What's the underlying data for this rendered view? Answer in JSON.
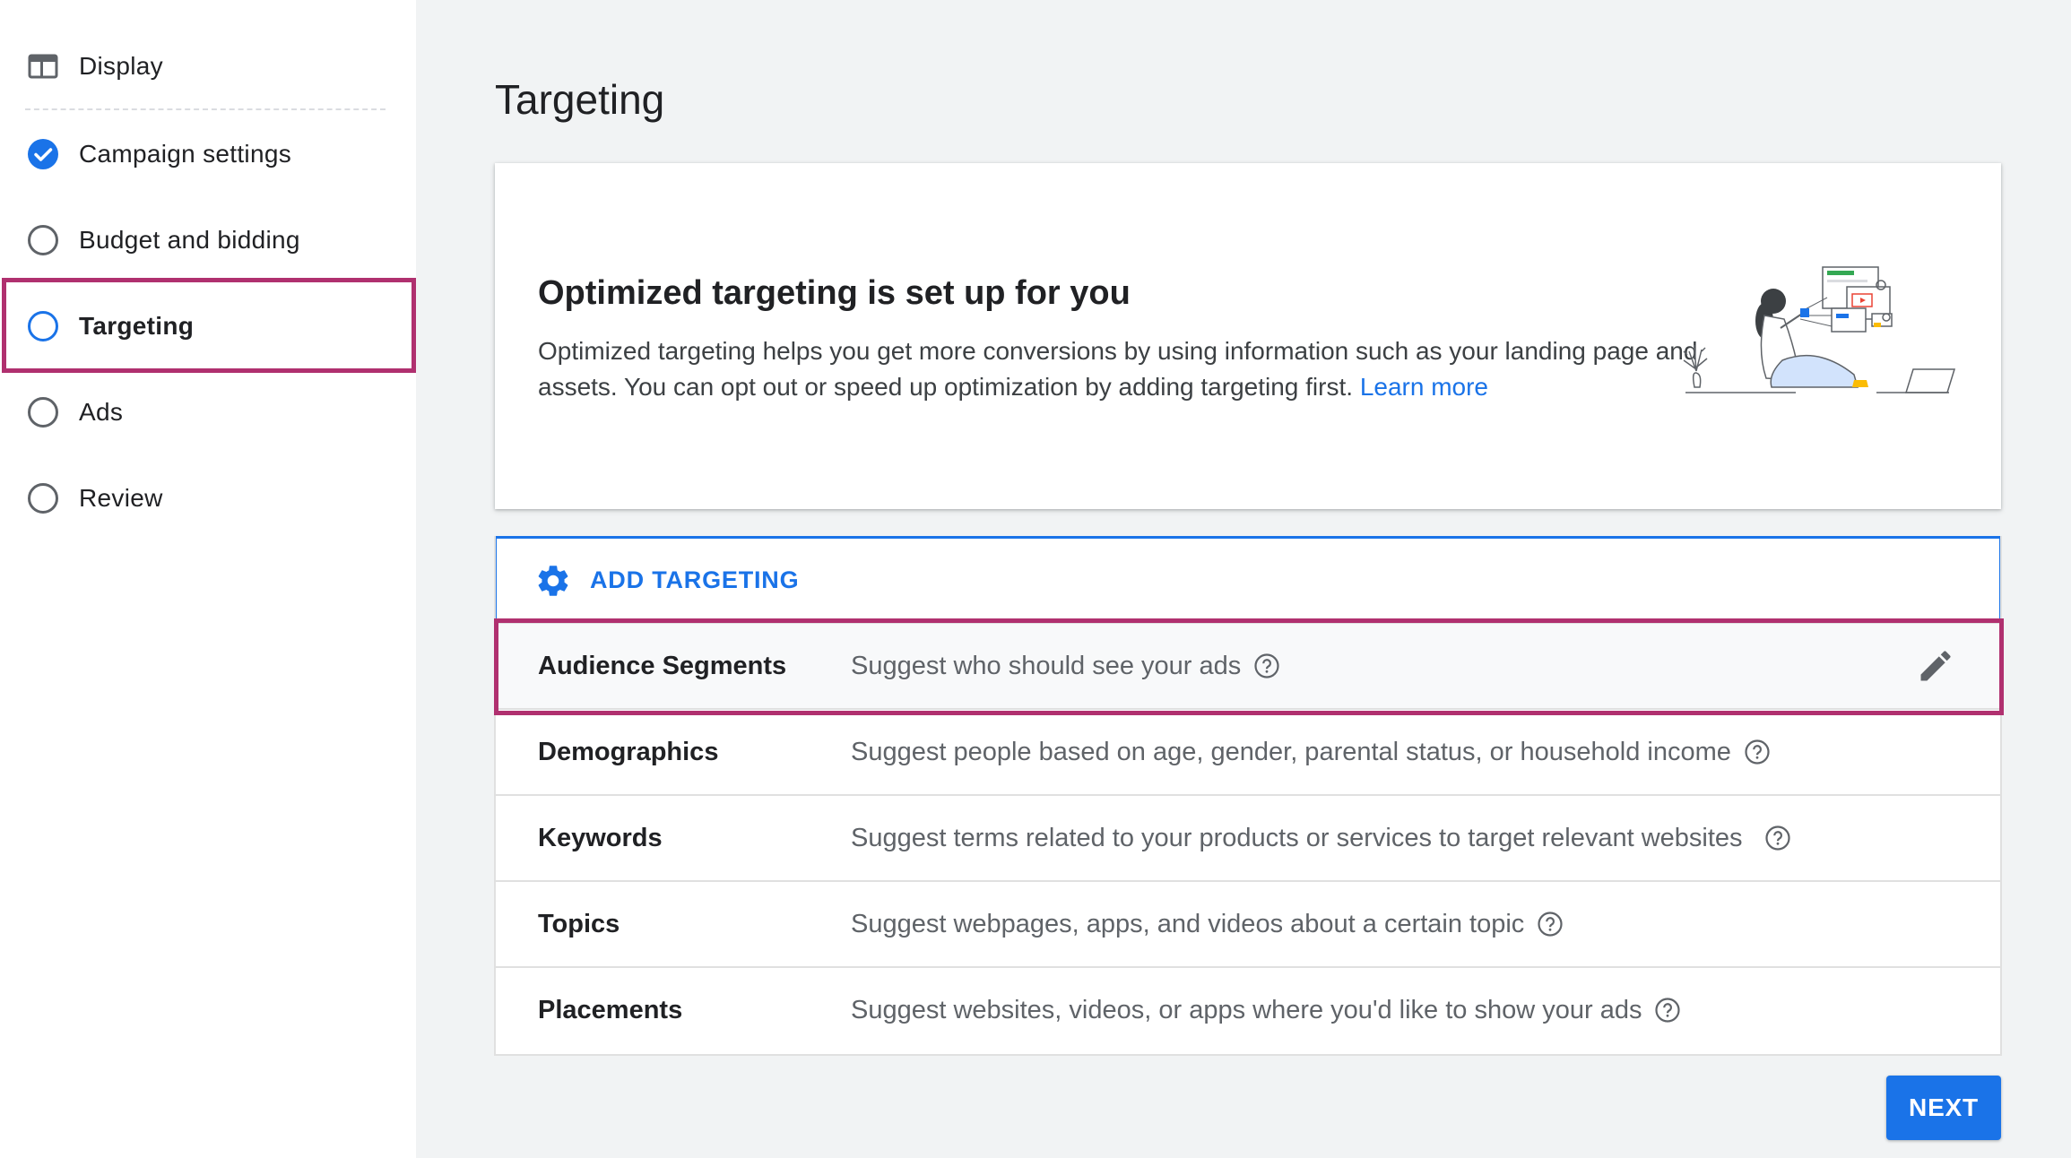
{
  "sidebar": {
    "items": [
      {
        "label": "Display",
        "icon": "display-icon",
        "state": "header"
      },
      {
        "label": "Campaign settings",
        "icon": "check-circle-icon",
        "state": "done"
      },
      {
        "label": "Budget and bidding",
        "icon": "circle-outline-icon",
        "state": "pending"
      },
      {
        "label": "Targeting",
        "icon": "circle-outline-blue-icon",
        "state": "active"
      },
      {
        "label": "Ads",
        "icon": "circle-outline-icon",
        "state": "pending"
      },
      {
        "label": "Review",
        "icon": "circle-outline-icon",
        "state": "pending"
      }
    ]
  },
  "main": {
    "title": "Targeting",
    "info_card": {
      "title": "Optimized targeting is set up for you",
      "body": "Optimized targeting helps you get more conversions by using information such as your landing page and assets. You can opt out or speed up optimization by adding targeting first.",
      "link": "Learn more"
    },
    "add_targeting": {
      "label": "ADD TARGETING",
      "icon": "gear-icon"
    },
    "rows": [
      {
        "name": "Audience Segments",
        "desc": "Suggest who should see your ads"
      },
      {
        "name": "Demographics",
        "desc": "Suggest people based on age, gender, parental status, or household income"
      },
      {
        "name": "Keywords",
        "desc": "Suggest terms related to your products or services to target relevant websites"
      },
      {
        "name": "Topics",
        "desc": "Suggest webpages, apps, and videos about a certain topic"
      },
      {
        "name": "Placements",
        "desc": "Suggest websites, videos, or apps where you'd like to show your ads"
      }
    ],
    "next_label": "NEXT"
  },
  "colors": {
    "accent": "#1a73e8",
    "highlight": "#b0306f",
    "background": "#f1f3f4"
  }
}
